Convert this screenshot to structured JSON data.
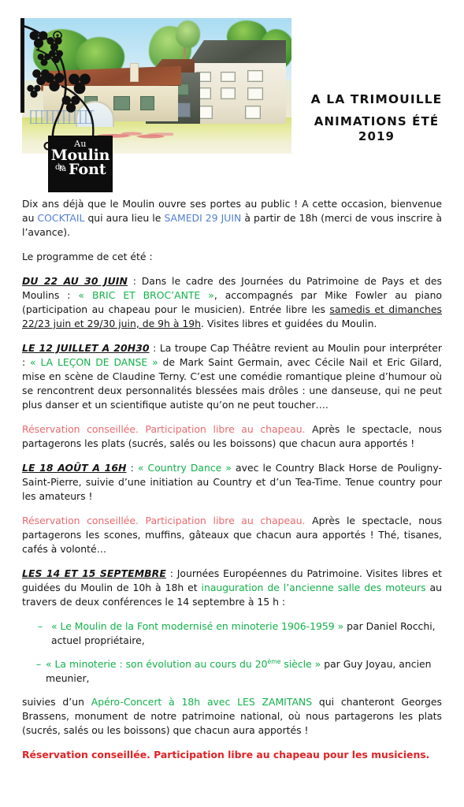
{
  "header": {
    "logo_sign": {
      "line1": "Au",
      "line2": "Moulin",
      "line3": "de",
      "line4": "Font",
      "line5": "la"
    },
    "title_line1": "A LA TRIMOUILLE",
    "title_line2": "ANIMATIONS ÉTÉ",
    "title_line3": "2019"
  },
  "intro": {
    "part1": "Dix ans déjà que le Moulin ouvre ses portes au public ! A cette occasion, bienvenue au ",
    "cocktail": "COCKTAIL",
    "part2": " qui aura lieu le ",
    "date": "SAMEDI 29 JUIN",
    "part3": " à partir de 18h (merci de vous inscrire à l’avance).",
    "programme": "Le programme de cet été :"
  },
  "events": [
    {
      "date": "DU 22 AU 30 JUIN",
      "sep": " : ",
      "text1": "Dans le cadre des Journées du Patrimoine de Pays et des Moulins : ",
      "highlight": "« BRIC ET BROC’ANTE »",
      "text2": ", accompagnés par Mike Fowler au piano (participation au chapeau pour le musicien). Entrée libre les ",
      "underlined": "samedis et dimanches 22/23 juin et 29/30 juin, de 9h à 19h",
      "text3": ". Visites libres et guidées du Moulin."
    },
    {
      "date": "LE 12 JUILLET A 20H30",
      "sep": " : ",
      "text1": "La troupe Cap Théâtre revient au Moulin pour interpréter : ",
      "highlight": "« LA LEÇON DE DANSE »",
      "text2": " de Mark Saint Germain, avec Cécile Nail et Eric Gilard, mise en scène de Claudine Terny. C’est une comédie romantique pleine d’humour où se rencontrent deux personnalités blessées mais drôles : une danseuse, qui ne peut plus danser et un scientifique autiste qu’on ne peut toucher…."
    },
    {
      "date": "LE 18 AOÛT A 16H",
      "sep": " : ",
      "highlight": "« Country Dance »",
      "text2": " avec le Country Black Horse de Pouligny-Saint-Pierre, suivie d’une initiation au Country et d’un Tea-Time. Tenue country pour les amateurs !"
    },
    {
      "date": "LES 14 ET 15 SEPTEMBRE",
      "sep": " : ",
      "text1": "Journées Européennes du Patrimoine. Visites libres et guidées du Moulin de 10h à 18h et ",
      "highlight": "inauguration de l’ancienne salle des moteurs",
      "text2": " au travers de deux conférences le 14 septembre à 15 h :"
    }
  ],
  "reservation_notes": [
    {
      "red": "Réservation conseillée. Participation libre au chapeau.",
      "black": " Après le spectacle, nous partagerons les plats (sucrés, salés ou les boissons) que chacun aura apportés !"
    },
    {
      "red": "Réservation conseillée. Participation libre au chapeau.",
      "black": " Après le spectacle, nous partagerons les scones, muffins, gâteaux que chacun aura apportés ! Thé, tisanes, cafés à volonté…"
    }
  ],
  "conferences": [
    {
      "dash": "–",
      "green": "« Le Moulin de la Font modernisé en minoterie 1906-1959 »",
      "black": " par Daniel Rocchi, actuel propriétaire,"
    },
    {
      "dash": "–",
      "green_pre": "« La minoterie : son évolution au cours du 20",
      "sup": "ème",
      "green_post": " siècle »",
      "black": " par Guy Joyau, ancien meunier,"
    }
  ],
  "closing": {
    "part1": "suivies d’un ",
    "green": "Apéro-Concert à 18h avec LES ZAMITANS",
    "part2": " qui chanteront Georges Brassens, monument de notre patrimoine national, où nous partagerons les plats (sucrés, salés ou les boissons) que chacun aura apportés !",
    "final_note": "Réservation conseillée. Participation libre au chapeau pour les musiciens."
  },
  "colors": {
    "blue": "#4f7fd0",
    "green": "#12b14a",
    "red_light": "#ea6a6e",
    "red_strong": "#e02326",
    "text": "#151515",
    "sign_background": "#0d0d0d"
  }
}
